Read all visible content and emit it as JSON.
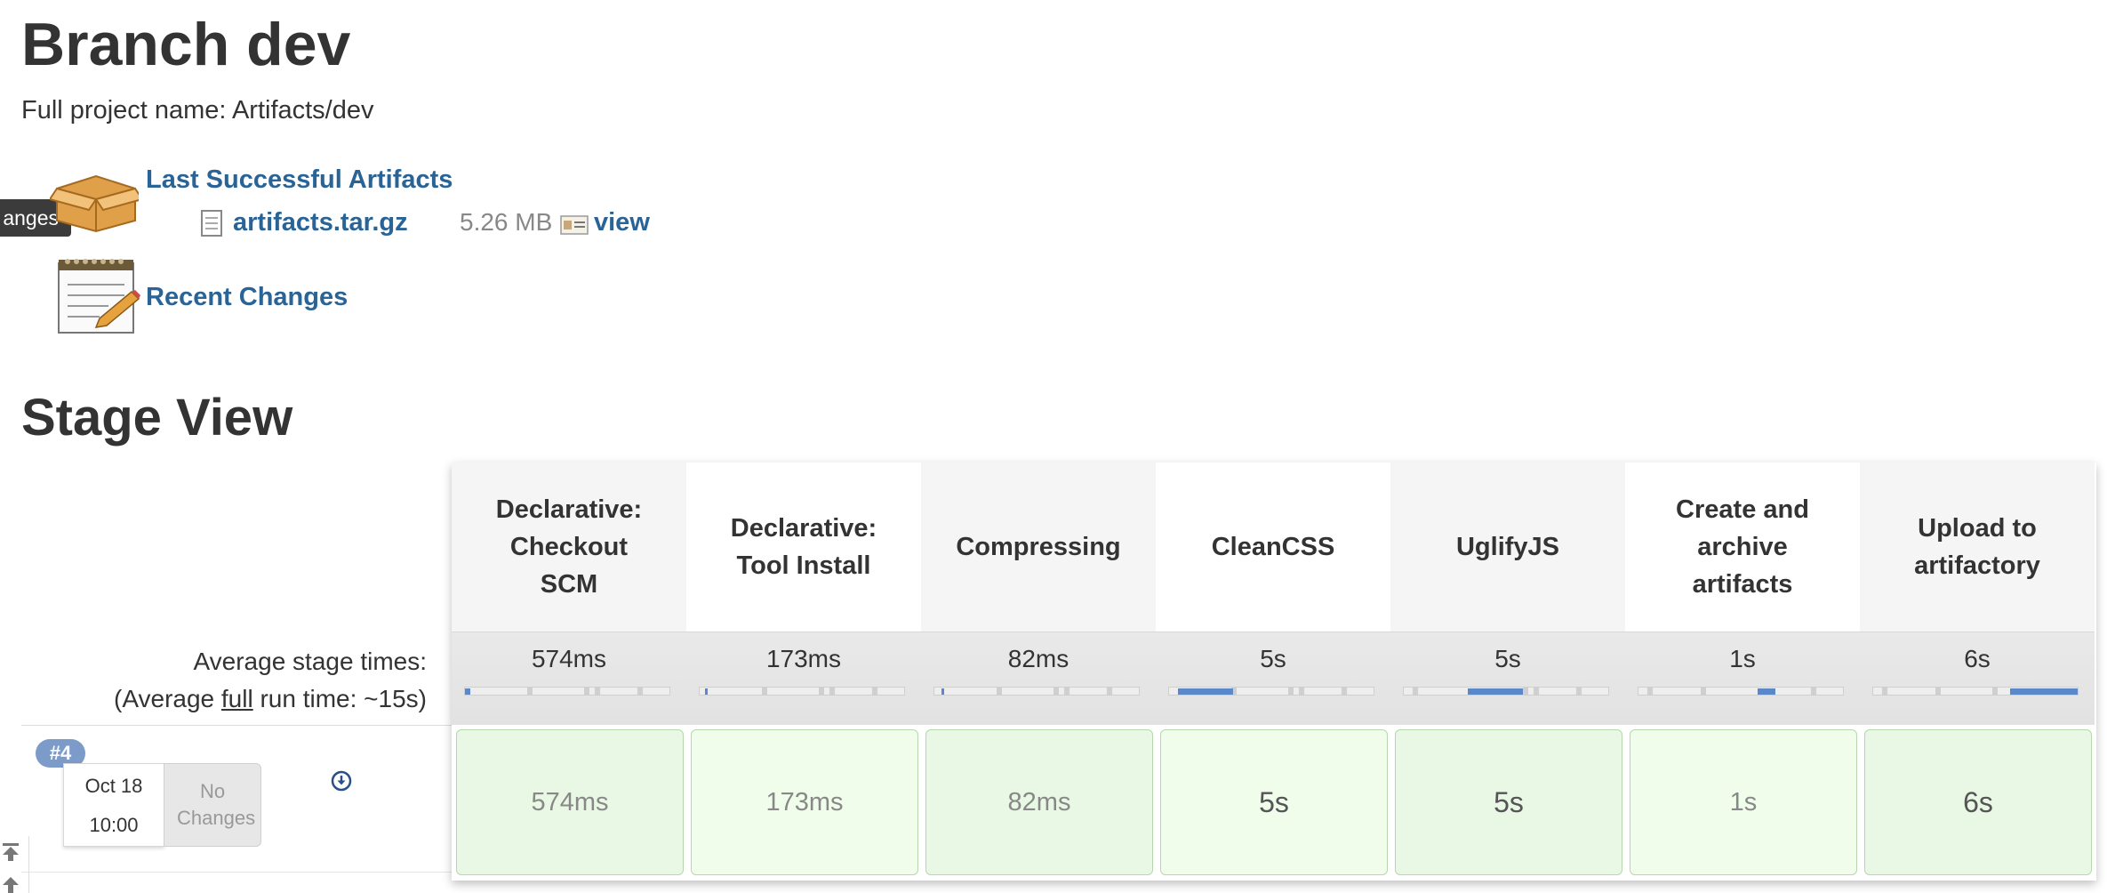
{
  "page": {
    "title": "Branch dev",
    "full_project_name": "Full project name: Artifacts/dev"
  },
  "tooltip": {
    "text": "anges"
  },
  "artifacts": {
    "section_label": "Last Successful Artifacts",
    "file_name": "artifacts.tar.gz",
    "file_size": "5.26 MB",
    "view_label": "view"
  },
  "recent_changes": {
    "label": "Recent Changes"
  },
  "stage_view": {
    "title": "Stage View",
    "average_label": "Average stage times:",
    "average_full_prefix": "(Average ",
    "average_full_word": "full",
    "average_full_suffix": " run time: ~15s)",
    "stages": [
      {
        "name": "Declarative: Checkout SCM",
        "avg": "574ms",
        "run": "574ms"
      },
      {
        "name": "Declarative: Tool Install",
        "avg": "173ms",
        "run": "173ms"
      },
      {
        "name": "Compressing",
        "avg": "82ms",
        "run": "82ms"
      },
      {
        "name": "CleanCSS",
        "avg": "5s",
        "run": "5s"
      },
      {
        "name": "UglifyJS",
        "avg": "5s",
        "run": "5s"
      },
      {
        "name": "Create and archive artifacts",
        "avg": "1s",
        "run": "1s"
      },
      {
        "name": "Upload to artifactory",
        "avg": "6s",
        "run": "6s"
      }
    ],
    "build": {
      "number": "#4",
      "date": "Oct 18",
      "time": "10:00",
      "changes": "No Changes"
    }
  },
  "colors": {
    "link": "#2a6496",
    "success_cell": "#e9f8e4",
    "progress_fill": "#5b88c9",
    "build_badge": "#7c9bc8"
  }
}
